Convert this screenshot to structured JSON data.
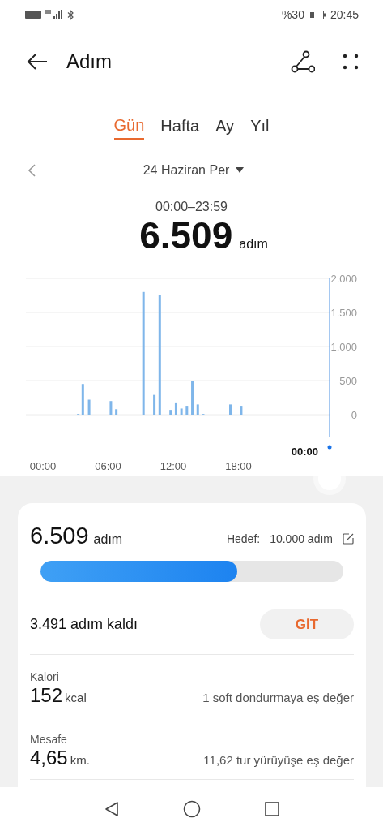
{
  "status_bar": {
    "battery_text": "%30",
    "time": "20:45"
  },
  "header": {
    "title": "Adım"
  },
  "tabs": [
    {
      "label": "Gün",
      "selected": true
    },
    {
      "label": "Hafta",
      "selected": false
    },
    {
      "label": "Ay",
      "selected": false
    },
    {
      "label": "Yıl",
      "selected": false
    }
  ],
  "date_nav": {
    "date": "24 Haziran Per"
  },
  "summary": {
    "time_range": "00:00–23:59",
    "value": "6.509",
    "unit": "adım"
  },
  "chart": {
    "cursor_label": "00:00",
    "chart_data": {
      "type": "bar",
      "grid": true,
      "xlim": [
        -1.57,
        26.38
      ],
      "ylim": [
        0,
        2000
      ],
      "xticks": [
        {
          "value": 0,
          "label": "00:00"
        },
        {
          "value": 6,
          "label": "06:00"
        },
        {
          "value": 12,
          "label": "12:00"
        },
        {
          "value": 18,
          "label": "18:00"
        }
      ],
      "yticks": [
        {
          "value": 0,
          "label": "0"
        },
        {
          "value": 500,
          "label": "500"
        },
        {
          "value": 1000,
          "label": "1.000"
        },
        {
          "value": 1500,
          "label": "1.500"
        },
        {
          "value": 2000,
          "label": "2.000"
        }
      ],
      "x": [
        3.25,
        3.67,
        4.25,
        6.25,
        6.75,
        9.25,
        10.25,
        10.75,
        11.75,
        12.25,
        12.75,
        13.25,
        13.75,
        14.25,
        14.75,
        17.25,
        18.25
      ],
      "series": [
        {
          "color": "#7fb6ea",
          "values": [
            10,
            450,
            220,
            200,
            80,
            1800,
            290,
            1760,
            70,
            180,
            90,
            130,
            500,
            150,
            10,
            150,
            130
          ]
        }
      ]
    }
  },
  "card": {
    "steps": "6.509",
    "unit": "adım",
    "goal_label": "Hedef:",
    "goal_value": "10.000 adım",
    "progress": {
      "level": 0.65
    },
    "remaining": "3.491 adım kaldı",
    "go_button": "GİT",
    "metrics": [
      {
        "label": "Kalori",
        "value": "152",
        "unit": "kcal",
        "equivalent": "1 soft dondurmaya eş değer"
      },
      {
        "label": "Mesafe",
        "value": "4,65",
        "unit": "km.",
        "equivalent": "11,62 tur yürüyüşe eş değer"
      }
    ]
  }
}
